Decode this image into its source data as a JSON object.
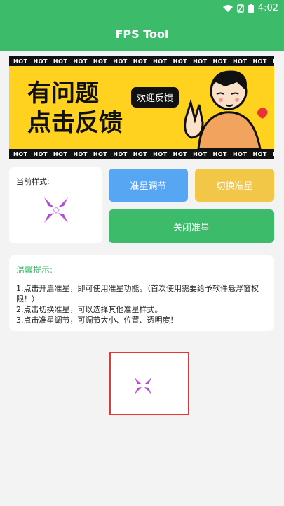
{
  "status_bar": {
    "time": "4:02"
  },
  "app_bar": {
    "title": "FPS Tool"
  },
  "banner": {
    "hot_label": "HOT",
    "title_line1": "有问题",
    "title_line2": "点击反馈",
    "speech": "欢迎反馈"
  },
  "crosshair_style": {
    "label": "当前样式:"
  },
  "buttons": {
    "adjust": "准星调节",
    "switch": "切换准星",
    "close": "关闭准星"
  },
  "tips": {
    "title": "温馨提示:",
    "lines": [
      "1.点击开启准星，即可使用准星功能。（首次使用需要给予软件悬浮窗权限！）",
      "2.点击切换准星，可以选择其他准星样式。",
      "3.点击准星调节，可调节大小、位置、透明度！"
    ]
  },
  "colors": {
    "primary": "#3cbc6a",
    "blue": "#57a6f4",
    "yellow": "#f2c647",
    "banner": "#ffd21f",
    "crosshair": "#b34fd2"
  }
}
